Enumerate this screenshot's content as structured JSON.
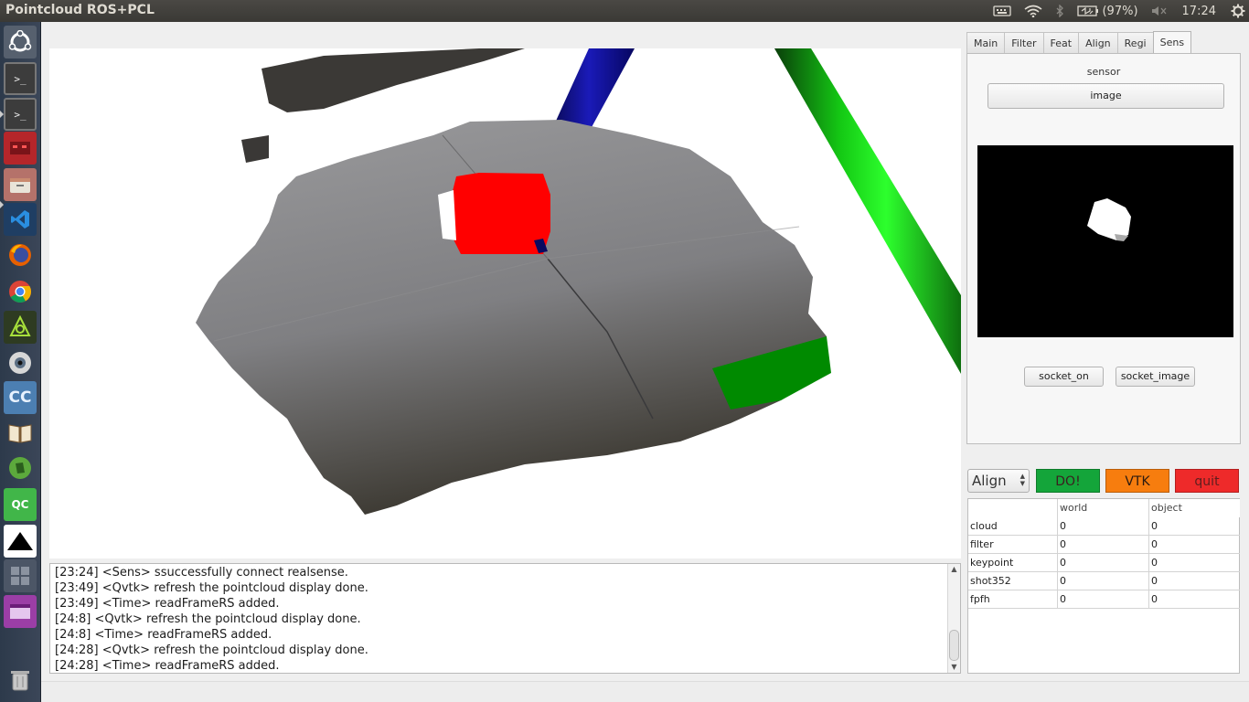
{
  "window": {
    "title": "Pointcloud ROS+PCL"
  },
  "tray": {
    "battery": "(97%)",
    "time": "17:24",
    "icons": [
      "keyboard-icon",
      "wifi-icon",
      "bluetooth-icon",
      "battery-icon",
      "volume-mute-icon",
      "gear-icon"
    ]
  },
  "launcher": [
    "ubuntu-icon",
    "terminal-icon",
    "terminal-icon",
    "red-app-icon",
    "files-icon",
    "vscode-icon",
    "firefox-icon",
    "chrome-icon",
    "tree-icon",
    "eye-icon",
    "cc-icon",
    "book-icon",
    "evernote-icon",
    "qc-icon",
    "black-triangle-icon",
    "workspace-icon",
    "window-icon",
    "trash-icon"
  ],
  "tabs": [
    {
      "label": "Main"
    },
    {
      "label": "Filter"
    },
    {
      "label": "Feat"
    },
    {
      "label": "Align"
    },
    {
      "label": "Regi"
    },
    {
      "label": "Sens"
    }
  ],
  "sens": {
    "sensor_label": "sensor",
    "image_button": "image",
    "socket_on_button": "socket_on",
    "socket_image_button": "socket_image"
  },
  "controls": {
    "mode_value": "Align",
    "do_button": "DO!",
    "vtk_button": "VTK",
    "quit_button": "quit",
    "colors": {
      "do": "#14a53a",
      "vtk": "#f77d0e",
      "quit": "#ee2a2a"
    }
  },
  "table": {
    "headers": [
      "",
      "world",
      "object"
    ],
    "rows": [
      [
        "cloud",
        "0",
        "0"
      ],
      [
        "filter",
        "0",
        "0"
      ],
      [
        "keypoint",
        "0",
        "0"
      ],
      [
        "shot352",
        "0",
        "0"
      ],
      [
        "fpfh",
        "0",
        "0"
      ]
    ]
  },
  "log": [
    "[23:24] <Sens>  ssuccessfully connect realsense.",
    "[23:49] <Qvtk>  refresh the pointcloud display done.",
    "[23:49] <Time>  readFrameRS added.",
    "[24:8] <Qvtk>  refresh the pointcloud display done.",
    "[24:8] <Time>  readFrameRS added.",
    "[24:28] <Qvtk>  refresh the pointcloud display done.",
    "[24:28] <Time>  readFrameRS added."
  ]
}
